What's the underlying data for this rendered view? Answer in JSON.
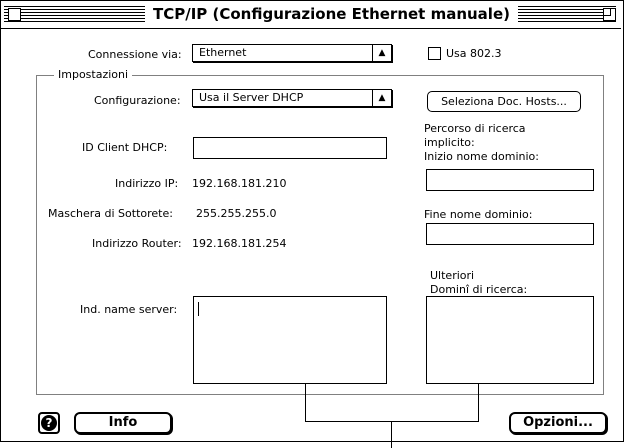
{
  "window": {
    "title": "TCP/IP (Configurazione Ethernet manuale)"
  },
  "connection": {
    "label": "Connessione via:",
    "value": "Ethernet",
    "use_8023_label": "Usa 802.3",
    "use_8023_checked": false
  },
  "settings": {
    "group_label": "Impostazioni",
    "config_label": "Configurazione:",
    "config_value": "Usa il Server DHCP",
    "select_hosts_button": "Seleziona Doc. Hosts...",
    "dhcp_client_id_label": "ID Client DHCP:",
    "dhcp_client_id_value": "",
    "ip_label": "Indirizzo IP:",
    "ip_value": "192.168.181.210",
    "subnet_label": "Maschera di Sottorete:",
    "subnet_value": "255.255.255.0",
    "router_label": "Indirizzo Router:",
    "router_value": "192.168.181.254",
    "name_server_label": "Ind. name server:",
    "name_server_value": "",
    "search_path_line1": "Percorso di ricerca",
    "search_path_line2": "implicito:",
    "domain_start_label": "Inizio nome dominio:",
    "domain_start_value": "",
    "domain_end_label": "Fine nome dominio:",
    "domain_end_value": "",
    "additional_line1": "Ulteriori",
    "additional_line2": "Dominî di ricerca:",
    "additional_value": ""
  },
  "footer": {
    "info_button": "Info",
    "options_button": "Opzioni...",
    "help_icon": "help-icon"
  }
}
